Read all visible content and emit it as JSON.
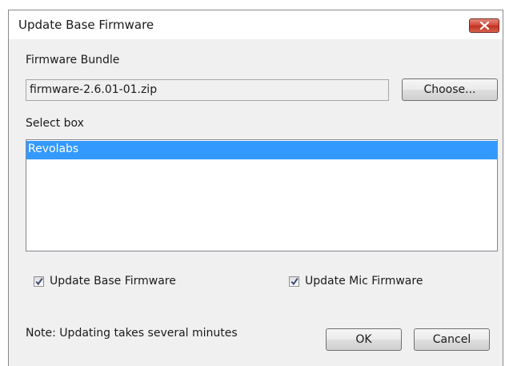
{
  "window": {
    "title": "Update Base Firmware",
    "close_icon": "close-icon"
  },
  "bundle": {
    "label": "Firmware Bundle",
    "value": "firmware-2.6.01-01.zip",
    "choose_label": "Choose..."
  },
  "select": {
    "label": "Select box",
    "items": [
      {
        "label": "Revolabs",
        "selected": true
      }
    ]
  },
  "options": {
    "update_base": {
      "label": "Update Base Firmware",
      "checked": true
    },
    "update_mic": {
      "label": "Update Mic Firmware",
      "checked": true
    }
  },
  "footer": {
    "note": "Note: Updating takes several minutes",
    "ok_label": "OK",
    "cancel_label": "Cancel"
  },
  "colors": {
    "selection": "#3399ff",
    "dialog_bg": "#f0f0f0",
    "close_button": "#c7402d"
  }
}
